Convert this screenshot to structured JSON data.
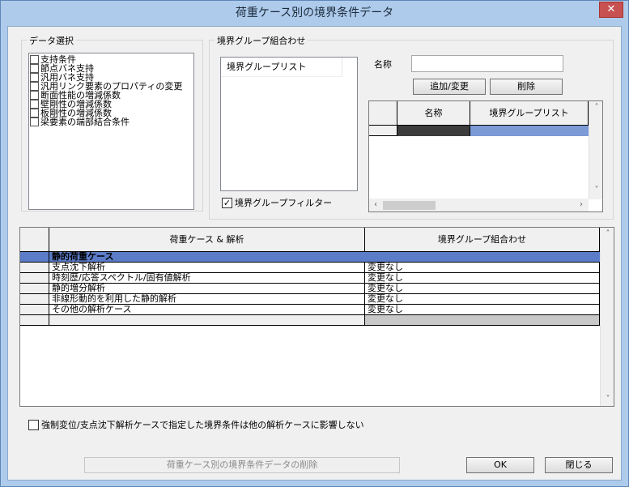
{
  "window": {
    "title": "荷重ケース別の境界条件データ",
    "close_label": "✕"
  },
  "data_select": {
    "label": "データ選択",
    "items": [
      "支持条件",
      "節点バネ支持",
      "汎用バネ支持",
      "汎用リンク要素のプロパティの変更",
      "断面性能の増減係数",
      "壁剛性の増減係数",
      "板剛性の増減係数",
      "梁要素の端部結合条件"
    ]
  },
  "bg_combo": {
    "label": "境界グループ組合わせ",
    "list_header": "境界グループリスト",
    "filter_label": "境界グループフィルター",
    "filter_checked": true,
    "name_label": "名称",
    "name_value": "",
    "add_button": "追加/変更",
    "delete_button": "削除",
    "table": {
      "col_name": "名称",
      "col_list": "境界グループリスト"
    }
  },
  "main_grid": {
    "col_case": "荷重ケース & 解析",
    "col_combo": "境界グループ組合わせ",
    "header_row": "静的荷重ケース",
    "rows": [
      {
        "case": "支点沈下解析",
        "combo": "変更なし"
      },
      {
        "case": "時刻歴/応答スペクトル/固有値解析",
        "combo": "変更なし"
      },
      {
        "case": "静的増分解析",
        "combo": "変更なし"
      },
      {
        "case": "非線形動的を利用した静的解析",
        "combo": "変更なし"
      },
      {
        "case": "その他の解析ケース",
        "combo": "変更なし"
      }
    ]
  },
  "options": {
    "force_label": "強制変位/支点沈下解析ケースで指定した境界条件は他の解析ケースに影響しない",
    "force_checked": false
  },
  "buttons": {
    "delete_data": "荷重ケース別の境界条件データの削除",
    "ok": "OK",
    "close": "閉じる"
  },
  "colors": {
    "selection": "#5b7cc9",
    "dark_cell": "#3c3c3c",
    "list_cell": "#7b9ad6"
  }
}
